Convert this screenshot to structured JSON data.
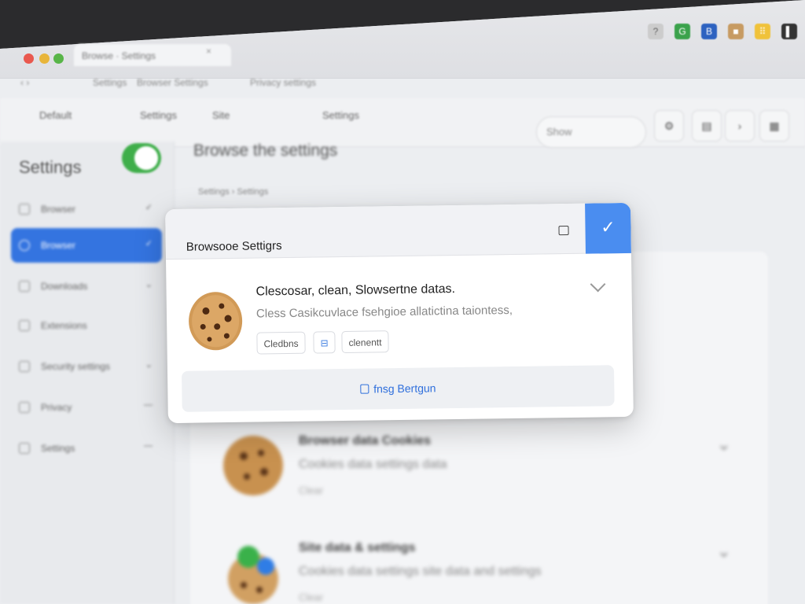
{
  "browser": {
    "tab_title": "Browse · Settings",
    "tab_close": "×",
    "url_items": [
      "Settings",
      "Browser Settings",
      "Privacy settings"
    ],
    "extensions": [
      "?",
      "G",
      "B",
      "■",
      "⠿",
      "▌"
    ],
    "toolbar_items": [
      "Default",
      "Settings",
      "Site",
      "Settings"
    ],
    "search_placeholder": "Show",
    "toolbar_buttons": [
      "⚙",
      "▤",
      "›",
      "▦"
    ]
  },
  "sidebar": {
    "title": "Settings",
    "items": [
      {
        "label": "Browser",
        "chevron": "✓"
      },
      {
        "label": "Browser",
        "chevron": "✓"
      },
      {
        "label": "Downloads",
        "chevron": "⌄"
      },
      {
        "label": "Extensions",
        "chevron": ""
      },
      {
        "label": "Security settings",
        "chevron": "⌄"
      },
      {
        "label": "Privacy",
        "chevron": "—"
      },
      {
        "label": "Settings",
        "chevron": "—"
      }
    ]
  },
  "main": {
    "heading": "Browse the settings",
    "breadcrumb": "Settings  ›  Settings",
    "rows": [
      {
        "title": "Browser data Cookies",
        "desc": "Cookies data settings data",
        "sub": "Clear"
      },
      {
        "title": "Site data & settings",
        "desc": "Cookies data settings site data and settings",
        "sub": "Clear"
      }
    ]
  },
  "dialog": {
    "title": "Browsooe Settigrs",
    "confirm": "✓",
    "option_title": "Clescosar, clean, Slowsertne datas.",
    "option_desc": "Cless Casikcuvlace fsehgioe allatictina taiontess,",
    "chips": [
      "Cledbns",
      "⊟",
      "clenentt"
    ],
    "action_label": "fnsg Bertgun"
  },
  "colors": {
    "accent": "#4a8df0",
    "sidebar_active": "#3474e0",
    "toggle_on": "#3fae4a"
  }
}
